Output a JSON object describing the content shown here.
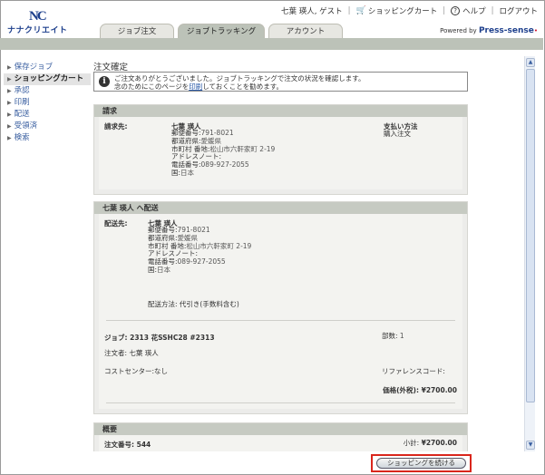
{
  "header": {
    "logo_mark": "NC",
    "logo_text": "ナナクリエイト",
    "user": "七葉 瑛人, ゲスト",
    "cart_label": "ショッピングカート",
    "help_label": "ヘルプ",
    "logout_label": "ログアウト",
    "powered_prefix": "Powered by",
    "powered_brand": "Press-sense"
  },
  "tabs": [
    "ジョブ注文",
    "ジョブトラッキング",
    "アカウント"
  ],
  "sidebar": [
    "保存ジョブ",
    "ショッピングカート",
    "承認",
    "印刷",
    "配送",
    "受領済",
    "検索"
  ],
  "page": {
    "title": "注文確定",
    "notice_line1": "ご注文ありがとうございました。ジョブトラッキングで注文の状況を確認します。",
    "notice_line2_pre": "念のためにこのページを",
    "notice_link": "印刷",
    "notice_line2_post": "しておくことを勧めます。"
  },
  "billing": {
    "header": "請求",
    "label": "請求先:",
    "name": "七葉 瑛人",
    "postal_label": "郵便番号:",
    "postal": "791-8021",
    "pref_label": "都道府県:",
    "pref": "愛媛県",
    "city_label": "市町村 番地:",
    "city": "松山市六軒家町 2-19",
    "address_note_label": "アドレスノート:",
    "phone_label": "電話番号:",
    "phone": "089-927-2055",
    "country_label": "国:",
    "country": "日本",
    "payment_label": "支払い方法",
    "payment": "購入注文"
  },
  "shipping": {
    "header": "七葉 瑛人 へ配送",
    "label": "配送先:",
    "name": "七葉 瑛人",
    "postal_label": "郵便番号:",
    "postal": "791-8021",
    "pref_label": "都道府県:",
    "pref": "愛媛県",
    "city_label": "市町村 番地:",
    "city": "松山市六軒家町 2-19",
    "address_note_label": "アドレスノート:",
    "phone_label": "電話番号:",
    "phone": "089-927-2055",
    "country_label": "国:",
    "country": "日本",
    "method_label": "配送方法:",
    "method": "代引き(手数料含む)",
    "job": "ジョブ: 2313 花SSHC28 #2313",
    "copies_label": "部数:",
    "copies": "1",
    "orderer_label": "注文者:",
    "orderer": "七葉 瑛人",
    "costcenter_label": "コストセンター:",
    "costcenter": "なし",
    "reference_label": "リファレンスコード:",
    "price_label": "価格(外税):",
    "price": "¥2700.00"
  },
  "summary": {
    "header": "概要",
    "order_label": "注文番号:",
    "order_no": "544",
    "subtotal_label": "小計:",
    "subtotal": "¥2700.00"
  },
  "continue_label": "ショッピングを続ける"
}
